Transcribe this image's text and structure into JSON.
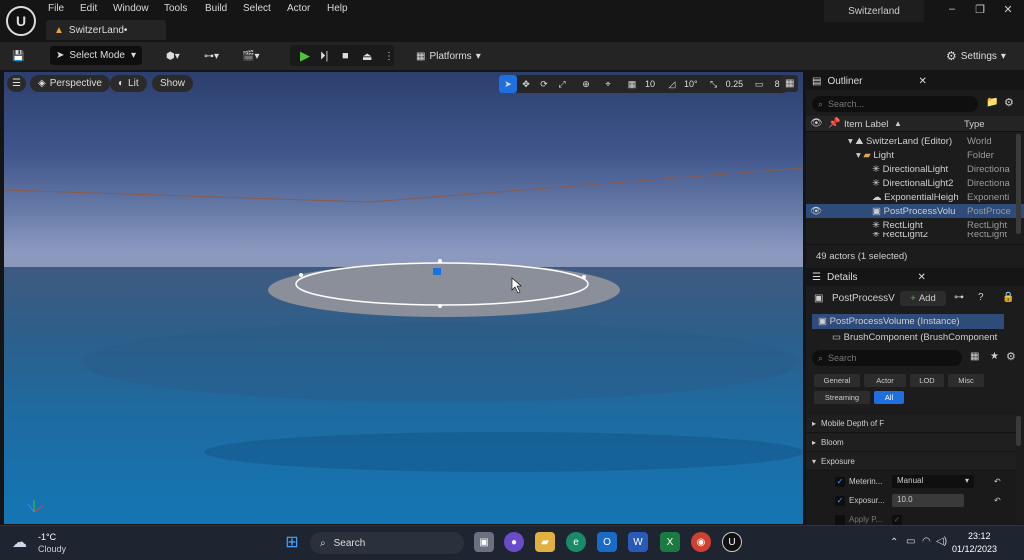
{
  "menubar": {
    "items": [
      "File",
      "Edit",
      "Window",
      "Tools",
      "Build",
      "Select",
      "Actor",
      "Help"
    ],
    "project_title": "Switzerland",
    "tab_label": "SwitzerLand•"
  },
  "toolbar": {
    "select_mode": "Select Mode",
    "platforms": "Platforms",
    "settings": "Settings"
  },
  "viewport": {
    "perspective": "Perspective",
    "lit": "Lit",
    "show": "Show",
    "grid_value": "10",
    "angle_value": "10°",
    "scale_value": "0.25",
    "camera_speed": "8"
  },
  "outliner": {
    "title": "Outliner",
    "search_placeholder": "Search...",
    "col_label": "Item Label",
    "col_type": "Type",
    "rows": [
      {
        "label": "SwitzerLand (Editor)",
        "type": "World"
      },
      {
        "label": "Light",
        "type": "Folder"
      },
      {
        "label": "DirectionalLight",
        "type": "Directiona"
      },
      {
        "label": "DirectionalLight2",
        "type": "Directiona"
      },
      {
        "label": "ExponentialHeigh",
        "type": "Exponenti"
      },
      {
        "label": "PostProcessVolu",
        "type": "PostProce"
      },
      {
        "label": "RectLight",
        "type": "RectLight"
      },
      {
        "label": "RectLight2",
        "type": "RectLight"
      }
    ],
    "status": "49 actors (1 selected)"
  },
  "details": {
    "title": "Details",
    "object_name": "PostProcessV",
    "add_label": "Add",
    "components": [
      "PostProcessVolume (Instance)",
      "BrushComponent (BrushComponent"
    ],
    "search_placeholder": "Search",
    "categories": [
      "General",
      "Actor",
      "LOD",
      "Misc",
      "Streaming",
      "All"
    ],
    "sections": [
      "Mobile Depth of F",
      "Bloom",
      "Exposure"
    ],
    "props": [
      {
        "label": "Meterin...",
        "value": "Manual"
      },
      {
        "label": "Exposur...",
        "value": "10.0"
      },
      {
        "label": "Apply P..."
      }
    ]
  },
  "taskbar": {
    "weather_temp": "-1°C",
    "weather_desc": "Cloudy",
    "search": "Search",
    "time": "23:12",
    "date": "01/12/2023"
  },
  "colors": {
    "accent": "#1f6fe0",
    "play": "#4fc43c",
    "selected_row": "#2e4b7a"
  }
}
